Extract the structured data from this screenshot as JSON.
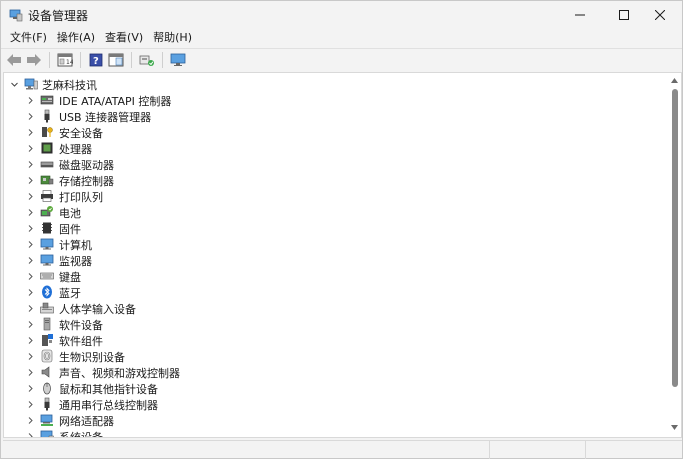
{
  "window": {
    "title": "设备管理器",
    "icon": "device-manager-icon"
  },
  "menu": [
    {
      "label": "文件(F)"
    },
    {
      "label": "操作(A)"
    },
    {
      "label": "查看(V)"
    },
    {
      "label": "帮助(H)"
    }
  ],
  "toolbar": [
    {
      "icon": "back-arrow-icon"
    },
    {
      "icon": "forward-arrow-icon"
    },
    {
      "icon": "properties-icon"
    },
    {
      "icon": "help-icon"
    },
    {
      "icon": "view-icon"
    },
    {
      "icon": "scan-hardware-icon"
    },
    {
      "icon": "monitor-icon"
    }
  ],
  "tree": {
    "root": {
      "label": "芝麻科技讯",
      "icon": "computer-root-icon",
      "expanded": true
    },
    "categories": [
      {
        "label": "IDE ATA/ATAPI 控制器",
        "icon": "ide-controller-icon"
      },
      {
        "label": "USB 连接器管理器",
        "icon": "usb-icon"
      },
      {
        "label": "安全设备",
        "icon": "security-key-icon"
      },
      {
        "label": "处理器",
        "icon": "processor-icon"
      },
      {
        "label": "磁盘驱动器",
        "icon": "disk-drive-icon"
      },
      {
        "label": "存储控制器",
        "icon": "storage-controller-icon"
      },
      {
        "label": "打印队列",
        "icon": "printer-icon"
      },
      {
        "label": "电池",
        "icon": "battery-icon"
      },
      {
        "label": "固件",
        "icon": "firmware-icon"
      },
      {
        "label": "计算机",
        "icon": "computer-icon"
      },
      {
        "label": "监视器",
        "icon": "monitor-icon"
      },
      {
        "label": "键盘",
        "icon": "keyboard-icon"
      },
      {
        "label": "蓝牙",
        "icon": "bluetooth-icon"
      },
      {
        "label": "人体学输入设备",
        "icon": "hid-icon"
      },
      {
        "label": "软件设备",
        "icon": "software-device-icon"
      },
      {
        "label": "软件组件",
        "icon": "software-component-icon"
      },
      {
        "label": "生物识别设备",
        "icon": "fingerprint-icon"
      },
      {
        "label": "声音、视频和游戏控制器",
        "icon": "speaker-icon"
      },
      {
        "label": "鼠标和其他指针设备",
        "icon": "mouse-icon"
      },
      {
        "label": "通用串行总线控制器",
        "icon": "usb-controller-icon"
      },
      {
        "label": "网络适配器",
        "icon": "network-adapter-icon"
      },
      {
        "label": "系统设备",
        "icon": "system-device-icon"
      }
    ]
  },
  "colors": {
    "accent": "#0078d4",
    "window_bg": "#f3f3f3",
    "panel_bg": "#ffffff"
  }
}
